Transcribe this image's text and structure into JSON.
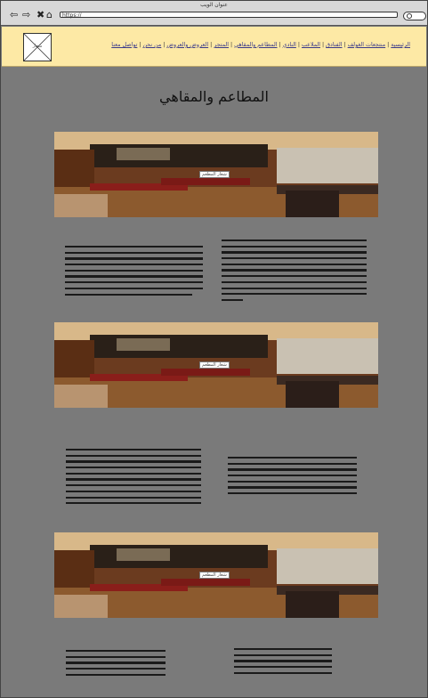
{
  "browser": {
    "title": "عنوان الويب",
    "url": "https://",
    "nav_icons": [
      "back-arrow-icon",
      "forward-arrow-icon",
      "close-icon",
      "home-icon"
    ]
  },
  "header": {
    "logo_alt": "شعار",
    "nav_items": [
      "الرئيسية",
      "منتجعات الغولف",
      "الفنادق",
      "الملاعب",
      "النادي",
      "المطاعم والمقاهي",
      "المتجر",
      "العروض والعروض",
      "من نحن",
      "تواصل معنا"
    ],
    "colors": {
      "background": "#fde9a5"
    }
  },
  "main": {
    "title": "المطاعم والمقاهي",
    "background": "#7a7a7a",
    "sections": [
      {
        "image_caption": "شعار المطعم"
      },
      {
        "image_caption": "شعار المطعم"
      },
      {
        "image_caption": "شعار المطعم"
      }
    ]
  }
}
